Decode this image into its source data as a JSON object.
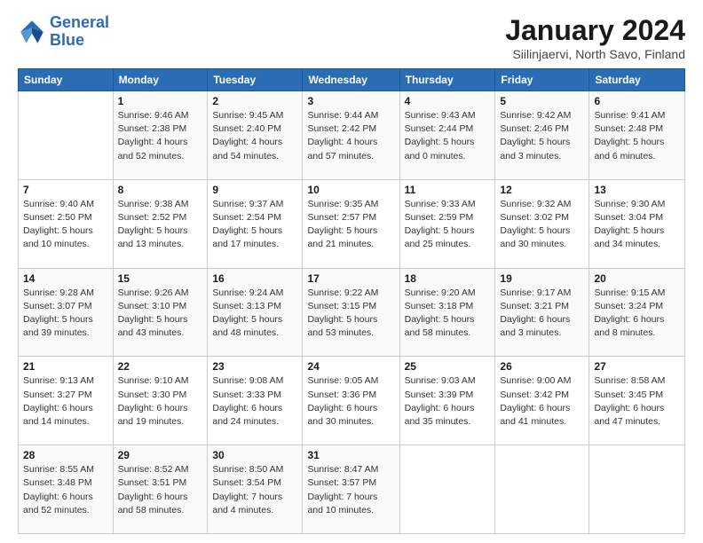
{
  "logo": {
    "line1": "General",
    "line2": "Blue"
  },
  "title": "January 2024",
  "subtitle": "Siilinjaervi, North Savo, Finland",
  "days_of_week": [
    "Sunday",
    "Monday",
    "Tuesday",
    "Wednesday",
    "Thursday",
    "Friday",
    "Saturday"
  ],
  "weeks": [
    [
      {
        "day": "",
        "info": ""
      },
      {
        "day": "1",
        "info": "Sunrise: 9:46 AM\nSunset: 2:38 PM\nDaylight: 4 hours\nand 52 minutes."
      },
      {
        "day": "2",
        "info": "Sunrise: 9:45 AM\nSunset: 2:40 PM\nDaylight: 4 hours\nand 54 minutes."
      },
      {
        "day": "3",
        "info": "Sunrise: 9:44 AM\nSunset: 2:42 PM\nDaylight: 4 hours\nand 57 minutes."
      },
      {
        "day": "4",
        "info": "Sunrise: 9:43 AM\nSunset: 2:44 PM\nDaylight: 5 hours\nand 0 minutes."
      },
      {
        "day": "5",
        "info": "Sunrise: 9:42 AM\nSunset: 2:46 PM\nDaylight: 5 hours\nand 3 minutes."
      },
      {
        "day": "6",
        "info": "Sunrise: 9:41 AM\nSunset: 2:48 PM\nDaylight: 5 hours\nand 6 minutes."
      }
    ],
    [
      {
        "day": "7",
        "info": "Sunrise: 9:40 AM\nSunset: 2:50 PM\nDaylight: 5 hours\nand 10 minutes."
      },
      {
        "day": "8",
        "info": "Sunrise: 9:38 AM\nSunset: 2:52 PM\nDaylight: 5 hours\nand 13 minutes."
      },
      {
        "day": "9",
        "info": "Sunrise: 9:37 AM\nSunset: 2:54 PM\nDaylight: 5 hours\nand 17 minutes."
      },
      {
        "day": "10",
        "info": "Sunrise: 9:35 AM\nSunset: 2:57 PM\nDaylight: 5 hours\nand 21 minutes."
      },
      {
        "day": "11",
        "info": "Sunrise: 9:33 AM\nSunset: 2:59 PM\nDaylight: 5 hours\nand 25 minutes."
      },
      {
        "day": "12",
        "info": "Sunrise: 9:32 AM\nSunset: 3:02 PM\nDaylight: 5 hours\nand 30 minutes."
      },
      {
        "day": "13",
        "info": "Sunrise: 9:30 AM\nSunset: 3:04 PM\nDaylight: 5 hours\nand 34 minutes."
      }
    ],
    [
      {
        "day": "14",
        "info": "Sunrise: 9:28 AM\nSunset: 3:07 PM\nDaylight: 5 hours\nand 39 minutes."
      },
      {
        "day": "15",
        "info": "Sunrise: 9:26 AM\nSunset: 3:10 PM\nDaylight: 5 hours\nand 43 minutes."
      },
      {
        "day": "16",
        "info": "Sunrise: 9:24 AM\nSunset: 3:13 PM\nDaylight: 5 hours\nand 48 minutes."
      },
      {
        "day": "17",
        "info": "Sunrise: 9:22 AM\nSunset: 3:15 PM\nDaylight: 5 hours\nand 53 minutes."
      },
      {
        "day": "18",
        "info": "Sunrise: 9:20 AM\nSunset: 3:18 PM\nDaylight: 5 hours\nand 58 minutes."
      },
      {
        "day": "19",
        "info": "Sunrise: 9:17 AM\nSunset: 3:21 PM\nDaylight: 6 hours\nand 3 minutes."
      },
      {
        "day": "20",
        "info": "Sunrise: 9:15 AM\nSunset: 3:24 PM\nDaylight: 6 hours\nand 8 minutes."
      }
    ],
    [
      {
        "day": "21",
        "info": "Sunrise: 9:13 AM\nSunset: 3:27 PM\nDaylight: 6 hours\nand 14 minutes."
      },
      {
        "day": "22",
        "info": "Sunrise: 9:10 AM\nSunset: 3:30 PM\nDaylight: 6 hours\nand 19 minutes."
      },
      {
        "day": "23",
        "info": "Sunrise: 9:08 AM\nSunset: 3:33 PM\nDaylight: 6 hours\nand 24 minutes."
      },
      {
        "day": "24",
        "info": "Sunrise: 9:05 AM\nSunset: 3:36 PM\nDaylight: 6 hours\nand 30 minutes."
      },
      {
        "day": "25",
        "info": "Sunrise: 9:03 AM\nSunset: 3:39 PM\nDaylight: 6 hours\nand 35 minutes."
      },
      {
        "day": "26",
        "info": "Sunrise: 9:00 AM\nSunset: 3:42 PM\nDaylight: 6 hours\nand 41 minutes."
      },
      {
        "day": "27",
        "info": "Sunrise: 8:58 AM\nSunset: 3:45 PM\nDaylight: 6 hours\nand 47 minutes."
      }
    ],
    [
      {
        "day": "28",
        "info": "Sunrise: 8:55 AM\nSunset: 3:48 PM\nDaylight: 6 hours\nand 52 minutes."
      },
      {
        "day": "29",
        "info": "Sunrise: 8:52 AM\nSunset: 3:51 PM\nDaylight: 6 hours\nand 58 minutes."
      },
      {
        "day": "30",
        "info": "Sunrise: 8:50 AM\nSunset: 3:54 PM\nDaylight: 7 hours\nand 4 minutes."
      },
      {
        "day": "31",
        "info": "Sunrise: 8:47 AM\nSunset: 3:57 PM\nDaylight: 7 hours\nand 10 minutes."
      },
      {
        "day": "",
        "info": ""
      },
      {
        "day": "",
        "info": ""
      },
      {
        "day": "",
        "info": ""
      }
    ]
  ]
}
